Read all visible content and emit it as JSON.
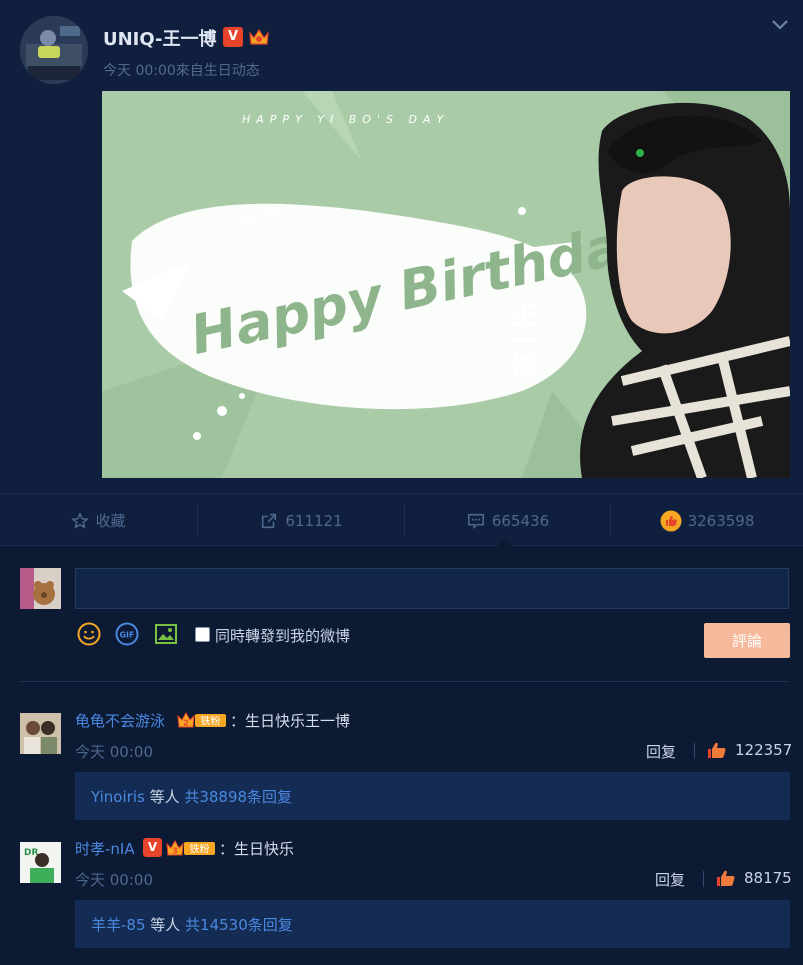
{
  "post": {
    "author": "UNIQ-王一博",
    "meta": "今天 00:00來自生日动态",
    "banner": {
      "tagline": "HAPPY YI BO'S DAY",
      "headline": "Happy Birthday",
      "date_stamp": "08.05",
      "name_vertical": "王一博"
    }
  },
  "actions": {
    "favorite": {
      "label": "收藏",
      "icon": "star-icon"
    },
    "repost": {
      "count": "611121",
      "icon": "share-icon"
    },
    "comment": {
      "count": "665436",
      "icon": "comment-icon"
    },
    "like": {
      "count": "3263598",
      "icon": "thumbs-up-icon"
    }
  },
  "composer": {
    "input_value": "",
    "repost_label": "同時轉發到我的微博",
    "submit_label": "評論",
    "tools": [
      "emoji-icon",
      "gif-icon",
      "image-icon"
    ]
  },
  "comments": [
    {
      "user": "龟龟不会游泳",
      "fan_level": "2",
      "fan_label": "铁粉",
      "text": "：生日快乐王一博",
      "time": "今天 00:00",
      "reply_label": "回复",
      "likes": "122357",
      "reply_user": "Yinoiris",
      "reply_mid": " 等人 ",
      "reply_count": "共38898条回复"
    },
    {
      "user": "时孝-nIA",
      "fan_level": "3",
      "fan_label": "铁粉",
      "text": "：生日快乐",
      "time": "今天 00:00",
      "reply_label": "回复",
      "likes": "88175",
      "reply_user": "羊羊-85",
      "reply_mid": " 等人 ",
      "reply_count": "共14530条回复"
    }
  ],
  "colors": {
    "background": "#0c1a33",
    "link": "#4a88e0",
    "submit": "#f7b99b",
    "verified": "#e8432b"
  }
}
